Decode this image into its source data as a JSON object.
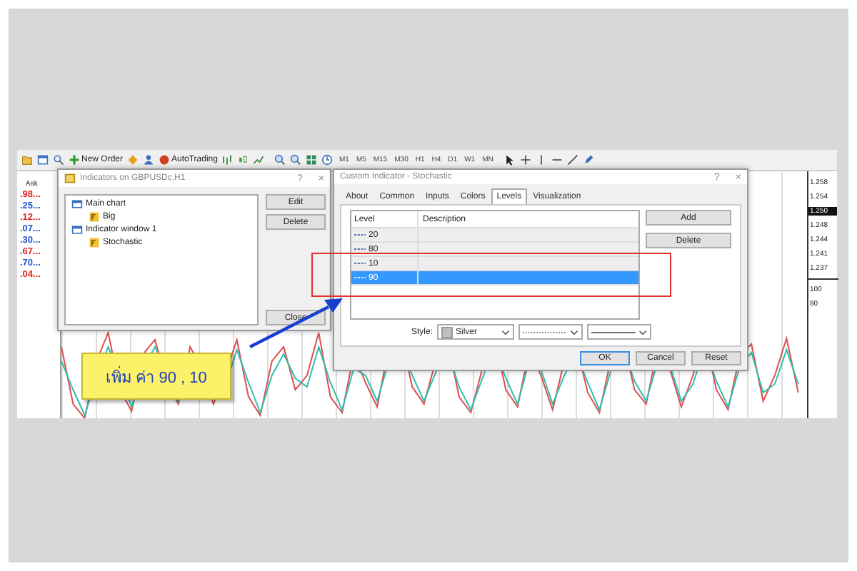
{
  "toolbar": {
    "buttons": [
      {
        "label": "New Order"
      },
      {
        "label": "AutoTrading"
      }
    ],
    "timeframes": [
      "M1",
      "M5",
      "M15",
      "M30",
      "H1",
      "H4",
      "D1",
      "W1",
      "MN"
    ]
  },
  "market_watch": {
    "header": "Ask",
    "prices": [
      {
        "text": ".98...",
        "color": "#e02020"
      },
      {
        "text": ".25...",
        "color": "#2050d0"
      },
      {
        "text": ".12...",
        "color": "#e02020"
      },
      {
        "text": ".07...",
        "color": "#2050d0"
      },
      {
        "text": ".30...",
        "color": "#2050d0"
      },
      {
        "text": ".67...",
        "color": "#e02020"
      },
      {
        "text": ".70...",
        "color": "#2050d0"
      },
      {
        "text": ".04...",
        "color": "#e02020"
      }
    ]
  },
  "price_axis": {
    "labels": [
      {
        "text": "1.258",
        "kind": "tick"
      },
      {
        "text": "1.254",
        "kind": "tick"
      },
      {
        "text": "1.250",
        "kind": "current"
      },
      {
        "text": "1.248",
        "kind": "tick"
      },
      {
        "text": "1.244",
        "kind": "tick"
      },
      {
        "text": "1.241",
        "kind": "tick"
      },
      {
        "text": "1.237",
        "kind": "tick"
      }
    ],
    "indicator_labels": [
      "100",
      "80"
    ]
  },
  "indicators_dialog": {
    "title": "Indicators on GBPUSDc,H1",
    "help": "?",
    "close": "×",
    "tree": [
      {
        "label": "Main chart",
        "children": [
          {
            "label": "Big"
          }
        ]
      },
      {
        "label": "Indicator window 1",
        "children": [
          {
            "label": "Stochastic"
          }
        ]
      }
    ],
    "buttons": [
      "Edit",
      "Delete"
    ],
    "close_button": "Close"
  },
  "custom_indicator_dialog": {
    "title": "Custom Indicator - Stochastic",
    "help": "?",
    "close": "×",
    "tabs": [
      {
        "label": "About",
        "selected": false
      },
      {
        "label": "Common",
        "selected": false
      },
      {
        "label": "Inputs",
        "selected": false
      },
      {
        "label": "Colors",
        "selected": false
      },
      {
        "label": "Levels",
        "selected": true
      },
      {
        "label": "Visualization",
        "selected": false
      }
    ],
    "table": {
      "columns": [
        "Level",
        "Description"
      ],
      "rows": [
        {
          "level": "20",
          "selected": false
        },
        {
          "level": "80",
          "selected": false
        },
        {
          "level": "10",
          "selected": false
        },
        {
          "level": "90",
          "selected": true
        }
      ]
    },
    "side_buttons": [
      "Add",
      "Delete"
    ],
    "style": {
      "label": "Style:",
      "color_name": "Silver"
    },
    "buttons": [
      "OK",
      "Cancel",
      "Reset"
    ]
  },
  "callout": {
    "text": "เพิ่ม ค่า 90 , 10"
  }
}
